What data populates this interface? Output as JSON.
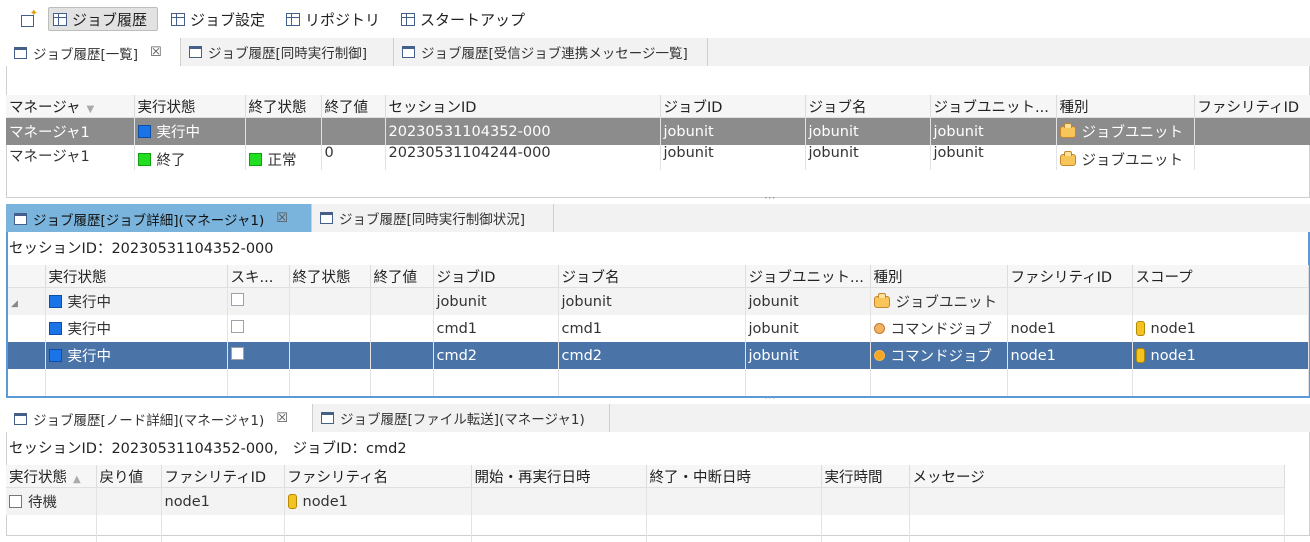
{
  "toolbar": {
    "items": [
      {
        "label": "ジョブ履歴",
        "active": true
      },
      {
        "label": "ジョブ設定",
        "active": false
      },
      {
        "label": "リポジトリ",
        "active": false
      },
      {
        "label": "スタートアップ",
        "active": false
      }
    ]
  },
  "panel1": {
    "tabs": [
      "ジョブ履歴[一覧]",
      "ジョブ履歴[同時実行制御]",
      "ジョブ履歴[受信ジョブ連携メッセージ一覧]"
    ],
    "columns": [
      "マネージャ",
      "実行状態",
      "終了状態",
      "終了値",
      "セッションID",
      "ジョブID",
      "ジョブ名",
      "ジョブユニット...",
      "種別",
      "ファシリティID"
    ],
    "rows": [
      {
        "manager": "マネージャ1",
        "status": "実行中",
        "end_status": "",
        "end_value": "",
        "session": "20230531104352-000",
        "job_id": "jobunit",
        "job_name": "jobunit",
        "jobunit": "jobunit",
        "type": "ジョブユニット",
        "facility": ""
      },
      {
        "manager": "マネージャ1",
        "status": "終了",
        "end_status": "正常",
        "end_value": "0",
        "session": "20230531104244-000",
        "job_id": "jobunit",
        "job_name": "jobunit",
        "jobunit": "jobunit",
        "type": "ジョブユニット",
        "facility": ""
      }
    ]
  },
  "panel2": {
    "tabs": [
      "ジョブ履歴[ジョブ詳細](マネージャ1)",
      "ジョブ履歴[同時実行制御状況]"
    ],
    "session_text": "セッションID：20230531104352-000",
    "columns": [
      "",
      "実行状態",
      "スキ...",
      "終了状態",
      "終了値",
      "ジョブID",
      "ジョブ名",
      "ジョブユニット...",
      "種別",
      "ファシリティID",
      "スコープ"
    ],
    "rows": [
      {
        "status": "実行中",
        "job_id": "jobunit",
        "job_name": "jobunit",
        "jobunit": "jobunit",
        "type": "ジョブユニット",
        "facility": "",
        "scope": ""
      },
      {
        "status": "実行中",
        "job_id": "cmd1",
        "job_name": "cmd1",
        "jobunit": "jobunit",
        "type": "コマンドジョブ",
        "facility": "node1",
        "scope": "node1"
      },
      {
        "status": "実行中",
        "job_id": "cmd2",
        "job_name": "cmd2",
        "jobunit": "jobunit",
        "type": "コマンドジョブ",
        "facility": "node1",
        "scope": "node1"
      }
    ]
  },
  "panel3": {
    "tabs": [
      "ジョブ履歴[ノード詳細](マネージャ1)",
      "ジョブ履歴[ファイル転送](マネージャ1)"
    ],
    "info_text": "セッションID：20230531104352-000,　ジョブID：cmd2",
    "columns": [
      "実行状態",
      "戻り値",
      "ファシリティID",
      "ファシリティ名",
      "開始・再実行日時",
      "終了・中断日時",
      "実行時間",
      "メッセージ"
    ],
    "rows": [
      {
        "status": "待機",
        "return": "",
        "facility_id": "node1",
        "facility_name": "node1",
        "start": "",
        "end": "",
        "duration": "",
        "message": ""
      }
    ]
  },
  "colors": {
    "running": "#1b73e8",
    "finished": "#22dd22",
    "selection": "#4a74a8",
    "active_tab": "#7ab4dc"
  }
}
